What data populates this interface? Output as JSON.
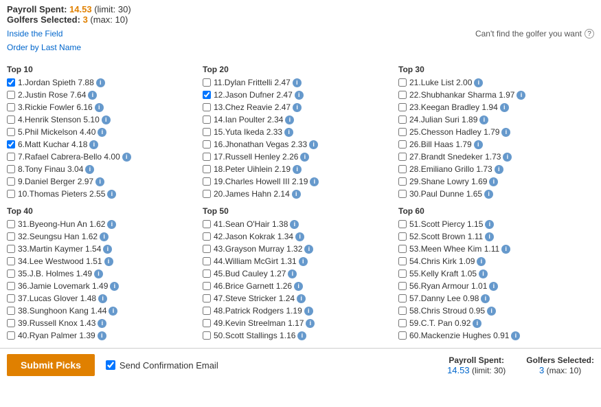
{
  "header": {
    "payroll_label": "Payroll Spent:",
    "payroll_value": "14.53",
    "payroll_limit": "(limit: 30)",
    "golfers_label": "Golfers Selected:",
    "golfers_value": "3",
    "golfers_max": "(max: 10)",
    "cant_find": "Can't find the golfer you want",
    "inside_field": "Inside the Field",
    "order_by": "Order by Last Name"
  },
  "footer": {
    "submit_label": "Submit Picks",
    "confirm_label": "Send Confirmation Email",
    "payroll_label": "Payroll Spent:",
    "payroll_value": "14.53",
    "payroll_limit": "(limit: 30)",
    "golfers_label": "Golfers Selected:",
    "golfers_value": "3",
    "golfers_max": "(max: 10)"
  },
  "sections": {
    "top10": {
      "title": "Top 10",
      "golfers": [
        {
          "num": "1.",
          "name": "Jordan Spieth",
          "score": "7.88",
          "checked": true
        },
        {
          "num": "2.",
          "name": "Justin Rose",
          "score": "7.64",
          "checked": false
        },
        {
          "num": "3.",
          "name": "Rickie Fowler",
          "score": "6.16",
          "checked": false
        },
        {
          "num": "4.",
          "name": "Henrik Stenson",
          "score": "5.10",
          "checked": false
        },
        {
          "num": "5.",
          "name": "Phil Mickelson",
          "score": "4.40",
          "checked": false
        },
        {
          "num": "6.",
          "name": "Matt Kuchar",
          "score": "4.18",
          "checked": true
        },
        {
          "num": "7.",
          "name": "Rafael Cabrera-Bello",
          "score": "4.00",
          "checked": false
        },
        {
          "num": "8.",
          "name": "Tony Finau",
          "score": "3.04",
          "checked": false
        },
        {
          "num": "9.",
          "name": "Daniel Berger",
          "score": "2.97",
          "checked": false
        },
        {
          "num": "10.",
          "name": "Thomas Pieters",
          "score": "2.55",
          "checked": false
        }
      ]
    },
    "top20": {
      "title": "Top 20",
      "golfers": [
        {
          "num": "11.",
          "name": "Dylan Frittelli",
          "score": "2.47",
          "checked": false
        },
        {
          "num": "12.",
          "name": "Jason Dufner",
          "score": "2.47",
          "checked": true
        },
        {
          "num": "13.",
          "name": "Chez Reavie",
          "score": "2.47",
          "checked": false
        },
        {
          "num": "14.",
          "name": "Ian Poulter",
          "score": "2.34",
          "checked": false
        },
        {
          "num": "15.",
          "name": "Yuta Ikeda",
          "score": "2.33",
          "checked": false
        },
        {
          "num": "16.",
          "name": "Jhonathan Vegas",
          "score": "2.33",
          "checked": false
        },
        {
          "num": "17.",
          "name": "Russell Henley",
          "score": "2.26",
          "checked": false
        },
        {
          "num": "18.",
          "name": "Peter Uihlein",
          "score": "2.19",
          "checked": false
        },
        {
          "num": "19.",
          "name": "Charles Howell III",
          "score": "2.19",
          "checked": false
        },
        {
          "num": "20.",
          "name": "James Hahn",
          "score": "2.14",
          "checked": false
        }
      ]
    },
    "top30": {
      "title": "Top 30",
      "golfers": [
        {
          "num": "21.",
          "name": "Luke List",
          "score": "2.00",
          "checked": false
        },
        {
          "num": "22.",
          "name": "Shubhankar Sharma",
          "score": "1.97",
          "checked": false
        },
        {
          "num": "23.",
          "name": "Keegan Bradley",
          "score": "1.94",
          "checked": false
        },
        {
          "num": "24.",
          "name": "Julian Suri",
          "score": "1.89",
          "checked": false
        },
        {
          "num": "25.",
          "name": "Chesson Hadley",
          "score": "1.79",
          "checked": false
        },
        {
          "num": "26.",
          "name": "Bill Haas",
          "score": "1.79",
          "checked": false
        },
        {
          "num": "27.",
          "name": "Brandt Snedeker",
          "score": "1.73",
          "checked": false
        },
        {
          "num": "28.",
          "name": "Emiliano Grillo",
          "score": "1.73",
          "checked": false
        },
        {
          "num": "29.",
          "name": "Shane Lowry",
          "score": "1.69",
          "checked": false
        },
        {
          "num": "30.",
          "name": "Paul Dunne",
          "score": "1.65",
          "checked": false
        }
      ]
    },
    "top40": {
      "title": "Top 40",
      "golfers": [
        {
          "num": "31.",
          "name": "Byeong-Hun An",
          "score": "1.62",
          "checked": false
        },
        {
          "num": "32.",
          "name": "Seungsu Han",
          "score": "1.62",
          "checked": false
        },
        {
          "num": "33.",
          "name": "Martin Kaymer",
          "score": "1.54",
          "checked": false
        },
        {
          "num": "34.",
          "name": "Lee Westwood",
          "score": "1.51",
          "checked": false
        },
        {
          "num": "35.",
          "name": "J.B. Holmes",
          "score": "1.49",
          "checked": false
        },
        {
          "num": "36.",
          "name": "Jamie Lovemark",
          "score": "1.49",
          "checked": false
        },
        {
          "num": "37.",
          "name": "Lucas Glover",
          "score": "1.48",
          "checked": false
        },
        {
          "num": "38.",
          "name": "Sunghoon Kang",
          "score": "1.44",
          "checked": false
        },
        {
          "num": "39.",
          "name": "Russell Knox",
          "score": "1.43",
          "checked": false
        },
        {
          "num": "40.",
          "name": "Ryan Palmer",
          "score": "1.39",
          "checked": false
        }
      ]
    },
    "top50": {
      "title": "Top 50",
      "golfers": [
        {
          "num": "41.",
          "name": "Sean O'Hair",
          "score": "1.38",
          "checked": false
        },
        {
          "num": "42.",
          "name": "Jason Kokrak",
          "score": "1.34",
          "checked": false
        },
        {
          "num": "43.",
          "name": "Grayson Murray",
          "score": "1.32",
          "checked": false
        },
        {
          "num": "44.",
          "name": "William McGirt",
          "score": "1.31",
          "checked": false
        },
        {
          "num": "45.",
          "name": "Bud Cauley",
          "score": "1.27",
          "checked": false
        },
        {
          "num": "46.",
          "name": "Brice Garnett",
          "score": "1.26",
          "checked": false
        },
        {
          "num": "47.",
          "name": "Steve Stricker",
          "score": "1.24",
          "checked": false
        },
        {
          "num": "48.",
          "name": "Patrick Rodgers",
          "score": "1.19",
          "checked": false
        },
        {
          "num": "49.",
          "name": "Kevin Streelman",
          "score": "1.17",
          "checked": false
        },
        {
          "num": "50.",
          "name": "Scott Stallings",
          "score": "1.16",
          "checked": false
        }
      ]
    },
    "top60": {
      "title": "Top 60",
      "golfers": [
        {
          "num": "51.",
          "name": "Scott Piercy",
          "score": "1.15",
          "checked": false
        },
        {
          "num": "52.",
          "name": "Scott Brown",
          "score": "1.11",
          "checked": false
        },
        {
          "num": "53.",
          "name": "Meen Whee Kim",
          "score": "1.11",
          "checked": false
        },
        {
          "num": "54.",
          "name": "Chris Kirk",
          "score": "1.09",
          "checked": false
        },
        {
          "num": "55.",
          "name": "Kelly Kraft",
          "score": "1.05",
          "checked": false
        },
        {
          "num": "56.",
          "name": "Ryan Armour",
          "score": "1.01",
          "checked": false
        },
        {
          "num": "57.",
          "name": "Danny Lee",
          "score": "0.98",
          "checked": false
        },
        {
          "num": "58.",
          "name": "Chris Stroud",
          "score": "0.95",
          "checked": false
        },
        {
          "num": "59.",
          "name": "C.T. Pan",
          "score": "0.92",
          "checked": false
        },
        {
          "num": "60.",
          "name": "Mackenzie Hughes",
          "score": "0.91",
          "checked": false
        }
      ]
    }
  }
}
